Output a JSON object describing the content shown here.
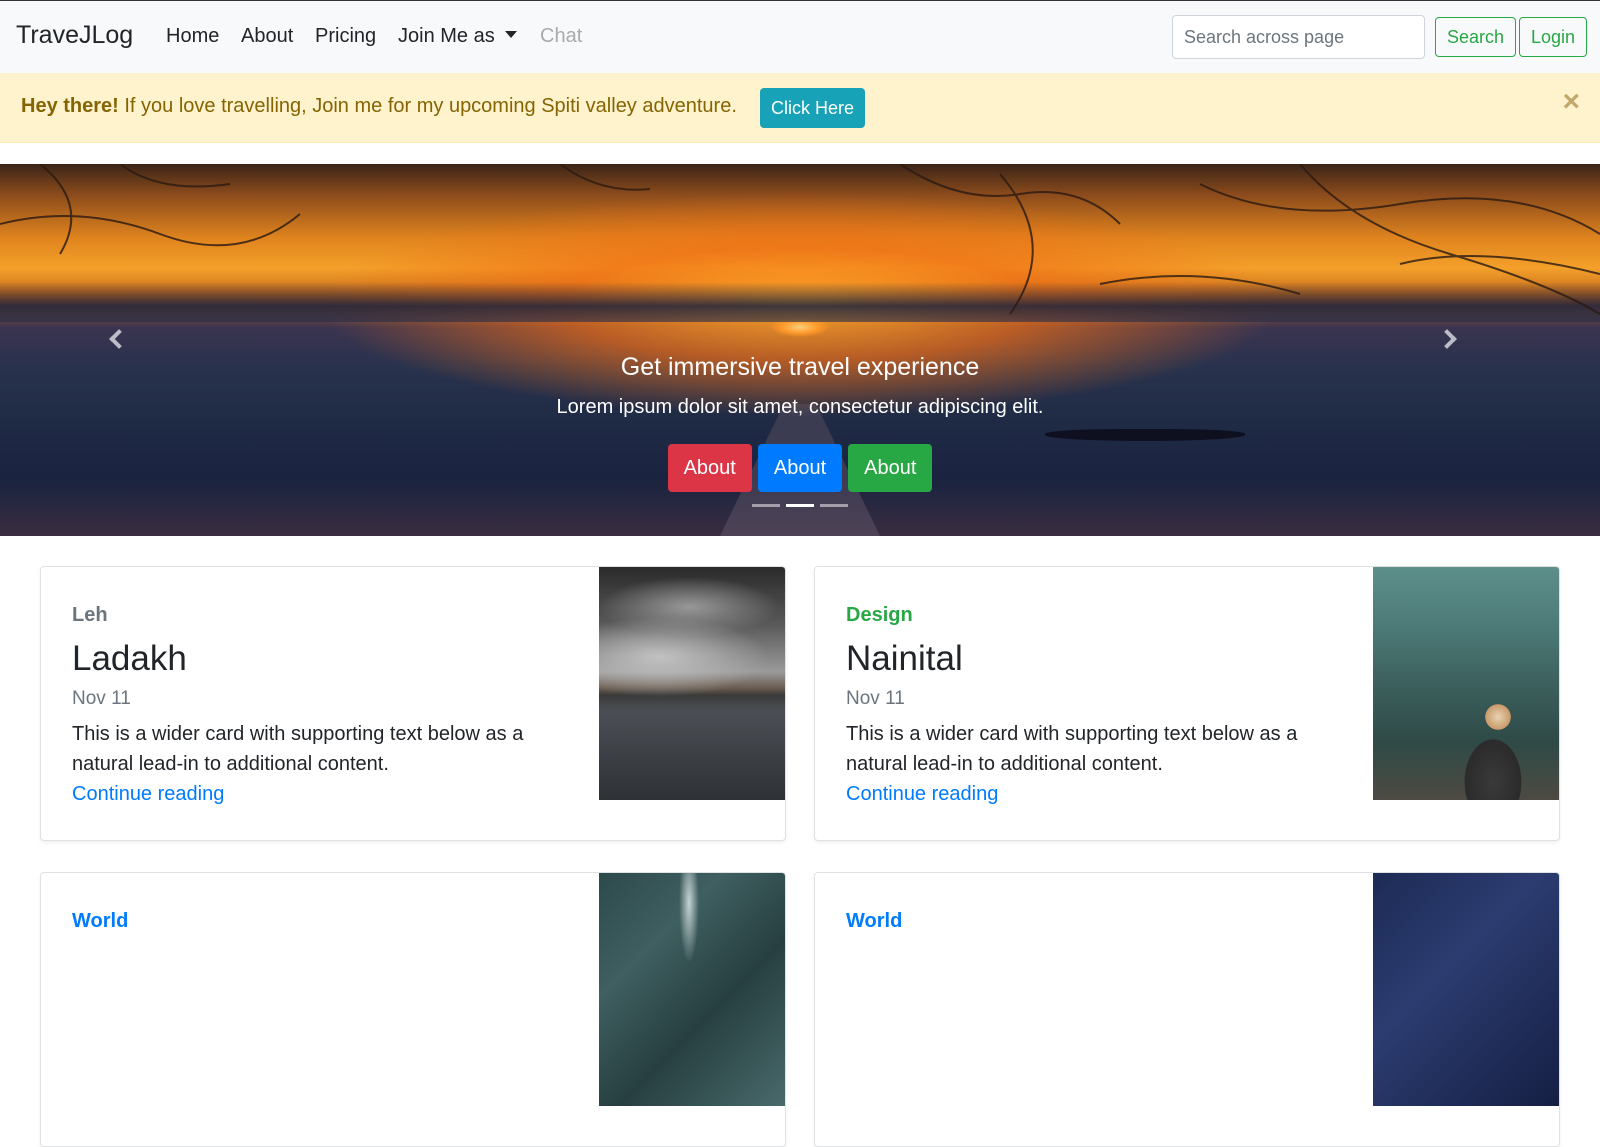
{
  "navbar": {
    "brand": "TraveJLog",
    "links": [
      "Home",
      "About",
      "Pricing"
    ],
    "dropdown_label": "Join Me as",
    "disabled_link": "Chat",
    "search_placeholder": "Search across page",
    "search_button": "Search",
    "login_button": "Login"
  },
  "alert": {
    "strong": "Hey there!",
    "message": " If you love travelling, Join me for my upcoming Spiti valley adventure.",
    "button": "Click Here",
    "close": "×"
  },
  "carousel": {
    "title": "Get immersive travel experience",
    "text": "Lorem ipsum dolor sit amet, consectetur adipiscing elit.",
    "buttons": [
      "About",
      "About",
      "About"
    ],
    "indicator_count": 3,
    "active_index": 1
  },
  "cards": [
    {
      "category": "Leh",
      "category_color": "#6c757d",
      "title": "Ladakh",
      "date": "Nov 11",
      "text": "This is a wider card with supporting text below as a natural lead-in to additional content.",
      "link": "Continue reading"
    },
    {
      "category": "Design",
      "category_color": "#28a745",
      "title": "Nainital",
      "date": "Nov 11",
      "text": "This is a wider card with supporting text below as a natural lead-in to additional content.",
      "link": "Continue reading"
    },
    {
      "category": "World",
      "category_color": "#007bff"
    },
    {
      "category": "World",
      "category_color": "#007bff"
    }
  ],
  "colors": {
    "success": "#28a745",
    "primary": "#007bff",
    "danger": "#dc3545",
    "info": "#17a2b8",
    "warning_bg": "#fff3cd",
    "warning_text": "#856404"
  }
}
